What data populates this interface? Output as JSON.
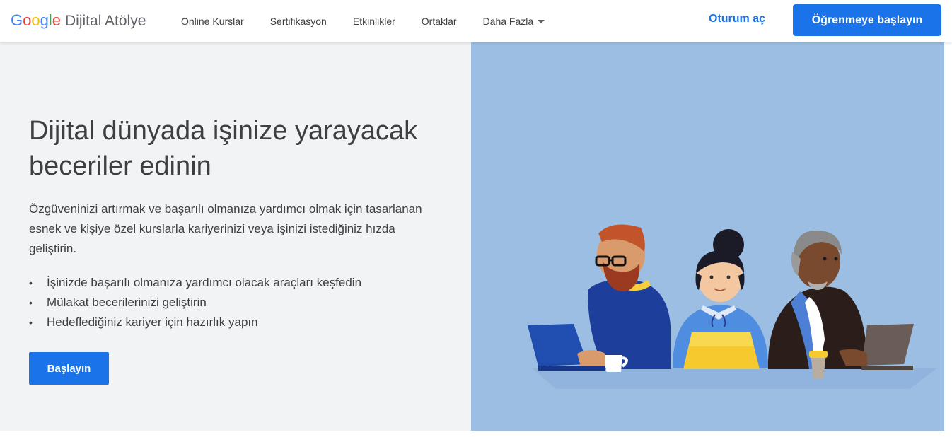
{
  "header": {
    "logo_google": [
      "G",
      "o",
      "o",
      "g",
      "l",
      "e"
    ],
    "logo_product": "Dijital Atölye",
    "nav": [
      {
        "label": "Online Kurslar"
      },
      {
        "label": "Sertifikasyon"
      },
      {
        "label": "Etkinlikler"
      },
      {
        "label": "Ortaklar"
      },
      {
        "label": "Daha Fazla",
        "has_dropdown": true
      }
    ],
    "signin_label": "Oturum aç",
    "cta_label": "Öğrenmeye başlayın"
  },
  "hero": {
    "title_line1": "Dijital dünyada işinize yarayacak",
    "title_line2": "beceriler edinin",
    "desc_line1": "Özgüveninizi artırmak ve başarılı olmanıza yardımcı olmak için tasarlanan",
    "desc_line2": "esnek ve kişiye özel kurslarla kariyerinizi veya işinizi istediğiniz hızda",
    "desc_line3": "geliştirin.",
    "bullets": [
      "İşinizde başarılı olmanıza yardımcı olacak araçları keşfedin",
      "Mülakat becerilerinizi geliştirin",
      "Hedeflediğiniz kariyer için hazırlık yapın"
    ],
    "start_label": "Başlayın"
  },
  "colors": {
    "accent": "#1a73e8",
    "hero_left_bg": "#f1f3f4",
    "hero_right_bg": "#9dbee3",
    "google_blue": "#4285f4",
    "google_red": "#ea4335",
    "google_yellow": "#fbbc05",
    "google_green": "#34a853"
  },
  "icons": {
    "dropdown": "caret-down-icon"
  }
}
